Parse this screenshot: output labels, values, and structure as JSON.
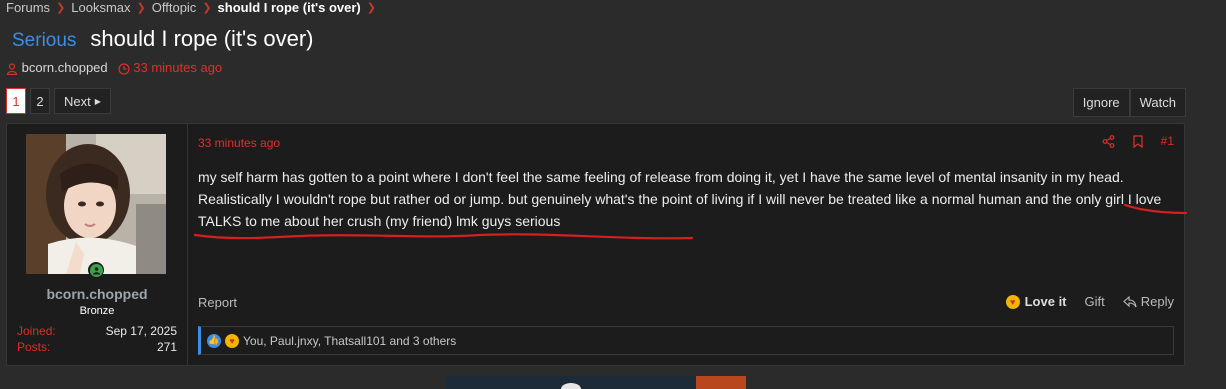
{
  "breadcrumb": {
    "items": [
      "Forums",
      "Looksmax",
      "Offtopic",
      "should I rope (it's over)"
    ]
  },
  "thread": {
    "prefix": "Serious",
    "title": "should I rope (it's over)",
    "author": "bcorn.chopped",
    "time": "33 minutes ago"
  },
  "pagination": {
    "pages": [
      "1",
      "2"
    ],
    "current": "1",
    "next_label": "Next"
  },
  "actions": {
    "ignore": "Ignore",
    "watch": "Watch"
  },
  "post": {
    "time": "33 minutes ago",
    "number": "#1",
    "body": "my self harm has gotten to a point where I don't feel the same feeling of release from doing it, yet I have the same level of mental insanity in my head. Realistically I wouldn't rope but rather od or jump. but genuinely what's the point of living if I will never be treated like a normal human and the only girl I love TALKS to me about her crush (my friend) lmk guys serious",
    "report": "Report",
    "love": "Love it",
    "gift": "Gift",
    "reply": "Reply",
    "reactions_text": "You, Paul.jnxy, Thatsall101 and 3 others"
  },
  "user": {
    "name": "bcorn.chopped",
    "rank": "Bronze",
    "joined_label": "Joined:",
    "joined_value": "Sep 17, 2025",
    "posts_label": "Posts:",
    "posts_value": "271"
  },
  "icons": {
    "share": "share-icon",
    "bookmark": "bookmark-icon",
    "user": "user-icon",
    "clock": "clock-icon"
  },
  "colors": {
    "accent_red": "#d9302a",
    "prefix_blue": "#3a8ee6",
    "annotation": "#d42020"
  }
}
